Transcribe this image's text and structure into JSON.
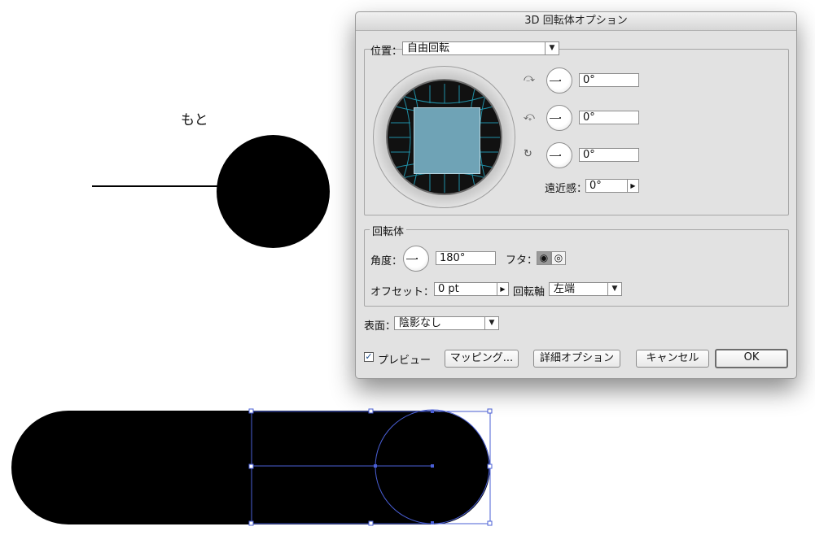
{
  "canvas": {
    "original_label": "もと"
  },
  "dialog": {
    "title": "3D 回転体オプション",
    "position": {
      "label": "位置：",
      "select_value": "自由回転",
      "rotations": [
        {
          "icon": "rotate-x-icon",
          "value": "0°"
        },
        {
          "icon": "rotate-y-icon",
          "value": "0°"
        },
        {
          "icon": "rotate-z-icon",
          "value": "0°"
        }
      ],
      "perspective_label": "遠近感：",
      "perspective_value": "0°"
    },
    "revolve": {
      "group_label": "回転体",
      "angle_label": "角度：",
      "angle_value": "180°",
      "cap_label": "フタ：",
      "offset_label": "オフセット：",
      "offset_value": "0 pt",
      "from_label": "回転軸",
      "from_value": "左端"
    },
    "surface": {
      "label": "表面：",
      "value": "陰影なし"
    },
    "buttons": {
      "preview_label": "プレビュー",
      "preview_checked": true,
      "mapping": "マッピング...",
      "more_options": "詳細オプション",
      "cancel": "キャンセル",
      "ok": "OK"
    },
    "colors": {
      "cube_face": "#6fa3b6",
      "grid_lines": "#1f8fa6",
      "selection": "#4a5fd6"
    }
  }
}
